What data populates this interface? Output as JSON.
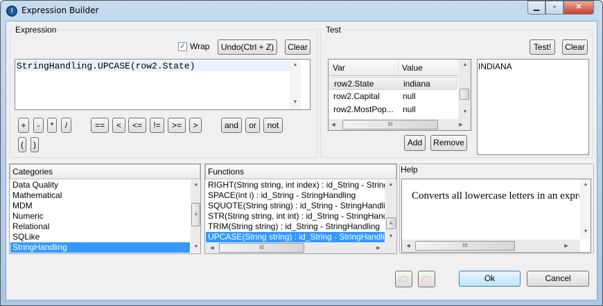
{
  "window": {
    "title": "Expression Builder",
    "min_icon": "minimize-icon",
    "max_icon": "maximize-icon",
    "close_icon": "close-icon"
  },
  "expression": {
    "label": "Expression",
    "wrap_label": "Wrap",
    "wrap_checked": true,
    "undo_label": "Undo(Ctrl + Z)",
    "clear_label": "Clear",
    "text": "StringHandling.UPCASE(row2.State)",
    "operators": [
      "+",
      "-",
      "*",
      "/",
      "==",
      "<",
      "<=",
      "!=",
      ">=",
      ">",
      "and",
      "or",
      "not",
      "(",
      ")"
    ]
  },
  "test": {
    "label": "Test",
    "test_label": "Test!",
    "clear_label": "Clear",
    "columns": [
      "Var",
      "Value"
    ],
    "rows": [
      {
        "var": "row2.State",
        "value": "indiana"
      },
      {
        "var": "row2.Capital",
        "value": "null"
      },
      {
        "var": "row2.MostPop...",
        "value": "null"
      }
    ],
    "add_label": "Add",
    "remove_label": "Remove",
    "result": "INDIANA"
  },
  "categories": {
    "header": "Categories",
    "items": [
      "Data Quality",
      "Mathematical",
      "MDM",
      "Numeric",
      "Relational",
      "SQLike",
      "StringHandling"
    ],
    "selected": "StringHandling"
  },
  "functions": {
    "header": "Functions",
    "items": [
      "RIGHT(String string, int index) : id_String - StringHandling",
      "SPACE(int i) : id_String - StringHandling",
      "SQUOTE(String string) : id_String - StringHandling",
      "STR(String string, int int) : id_String - StringHandling",
      "TRIM(String string) : id_String - StringHandling",
      "UPCASE(String string) : id_String - StringHandling"
    ],
    "selected": "UPCASE(String string) : id_String - StringHandling"
  },
  "help": {
    "label": "Help",
    "text": "Converts all lowercase letters in an expression to uppercase."
  },
  "footer": {
    "import_icon": "import-folder-icon",
    "export_icon": "export-folder-icon",
    "ok_label": "Ok",
    "cancel_label": "Cancel"
  }
}
